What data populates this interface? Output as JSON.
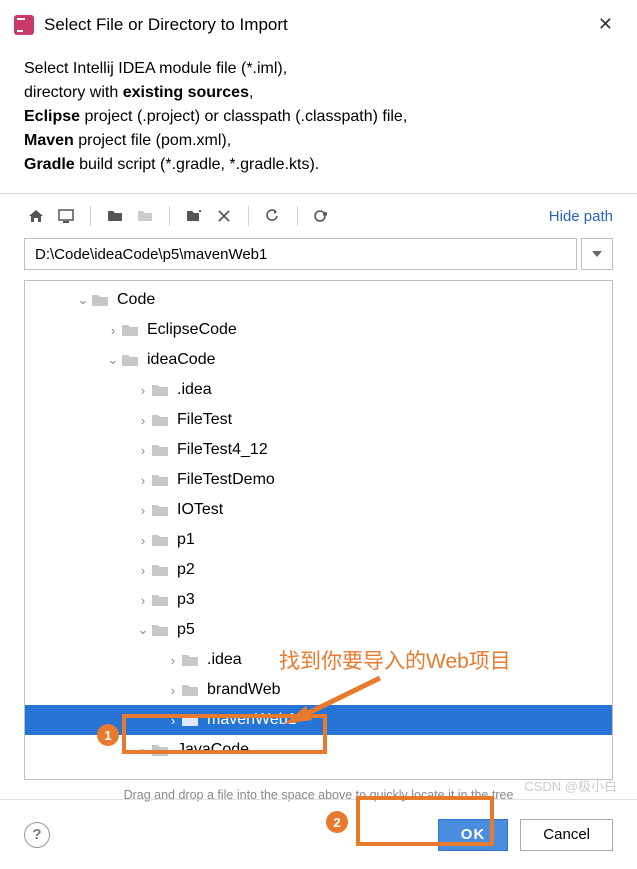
{
  "titlebar": {
    "title": "Select File or Directory to Import"
  },
  "description": {
    "parts": [
      {
        "t": "Select Intellij IDEA module file (*.iml),"
      },
      {
        "t": "directory with ",
        "b": "existing sources",
        "t2": ","
      },
      {
        "b": "Eclipse",
        "t": " project (.project) or classpath (.classpath) file,"
      },
      {
        "b": "Maven",
        "t": " project file (pom.xml),"
      },
      {
        "b": "Gradle",
        "t": " build script (*.gradle, *.gradle.kts)."
      }
    ]
  },
  "toolbar": {
    "hide_path": "Hide path"
  },
  "path": {
    "value": "D:\\Code\\ideaCode\\p5\\mavenWeb1"
  },
  "tree": [
    {
      "indent": 1,
      "exp": "open",
      "label": "Code"
    },
    {
      "indent": 2,
      "exp": "closed",
      "label": "EclipseCode"
    },
    {
      "indent": 2,
      "exp": "open",
      "label": "ideaCode"
    },
    {
      "indent": 3,
      "exp": "closed",
      "label": ".idea"
    },
    {
      "indent": 3,
      "exp": "closed",
      "label": "FileTest"
    },
    {
      "indent": 3,
      "exp": "closed",
      "label": "FileTest4_12"
    },
    {
      "indent": 3,
      "exp": "closed",
      "label": "FileTestDemo"
    },
    {
      "indent": 3,
      "exp": "closed",
      "label": "IOTest"
    },
    {
      "indent": 3,
      "exp": "closed",
      "label": "p1"
    },
    {
      "indent": 3,
      "exp": "closed",
      "label": "p2"
    },
    {
      "indent": 3,
      "exp": "closed",
      "label": "p3"
    },
    {
      "indent": 3,
      "exp": "open",
      "label": "p5"
    },
    {
      "indent": 4,
      "exp": "closed",
      "label": ".idea"
    },
    {
      "indent": 4,
      "exp": "closed",
      "label": "brandWeb"
    },
    {
      "indent": 4,
      "exp": "closed",
      "label": "mavenWeb1",
      "selected": true
    },
    {
      "indent": 3,
      "exp": "closed",
      "label": "JavaCode"
    }
  ],
  "hint": "Drag and drop a file into the space above to quickly locate it in the tree",
  "footer": {
    "ok": "OK",
    "cancel": "Cancel",
    "help": "?"
  },
  "annotations": {
    "callout_text": "找到你要导入的Web项目",
    "badge1": "1",
    "badge2": "2"
  },
  "watermark": "CSDN @极小白"
}
